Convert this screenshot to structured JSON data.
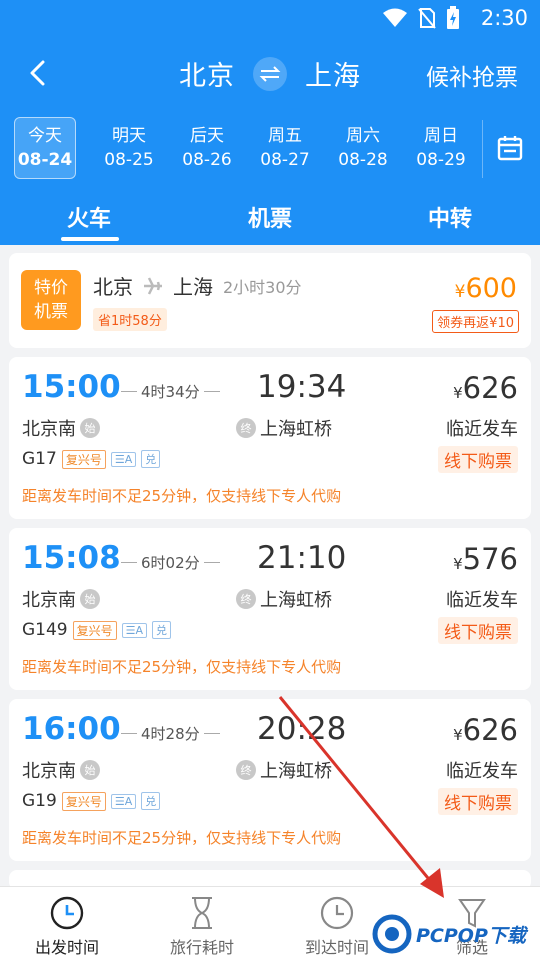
{
  "status": {
    "time": "2:30"
  },
  "header": {
    "from_city": "北京",
    "to_city": "上海",
    "right_action": "候补抢票"
  },
  "dates": [
    {
      "label": "今天",
      "date": "08-24",
      "active": true
    },
    {
      "label": "明天",
      "date": "08-25"
    },
    {
      "label": "后天",
      "date": "08-26"
    },
    {
      "label": "周五",
      "date": "08-27"
    },
    {
      "label": "周六",
      "date": "08-28"
    },
    {
      "label": "周日",
      "date": "08-29"
    }
  ],
  "tabs": [
    {
      "label": "火车",
      "active": true
    },
    {
      "label": "机票"
    },
    {
      "label": "中转"
    }
  ],
  "promo": {
    "badge": "特价机票",
    "from": "北京",
    "to": "上海",
    "duration": "2小时30分",
    "save": "省1时58分",
    "price_symbol": "¥",
    "price": "600",
    "coupon": "领券再返¥10"
  },
  "trains": [
    {
      "dep_time": "15:00",
      "duration": "4时34分",
      "arr_time": "19:34",
      "price_symbol": "¥",
      "price": "626",
      "from": "北京南",
      "from_mark": "始",
      "to": "上海虹桥",
      "to_mark": "终",
      "status": "临近发车",
      "train_no": "G17",
      "tag": "复兴号",
      "tag2": "☰A",
      "tag3": "兑",
      "buy": "线下购票",
      "note": "距离发车时间不足25分钟，仅支持线下专人代购"
    },
    {
      "dep_time": "15:08",
      "duration": "6时02分",
      "arr_time": "21:10",
      "price_symbol": "¥",
      "price": "576",
      "from": "北京南",
      "from_mark": "始",
      "to": "上海虹桥",
      "to_mark": "终",
      "status": "临近发车",
      "train_no": "G149",
      "tag": "复兴号",
      "tag2": "☰A",
      "tag3": "兑",
      "buy": "线下购票",
      "note": "距离发车时间不足25分钟，仅支持线下专人代购"
    },
    {
      "dep_time": "16:00",
      "duration": "4时28分",
      "arr_time": "20:28",
      "price_symbol": "¥",
      "price": "626",
      "from": "北京南",
      "from_mark": "始",
      "to": "上海虹桥",
      "to_mark": "终",
      "status": "临近发车",
      "train_no": "G19",
      "tag": "复兴号",
      "tag2": "☰A",
      "tag3": "兑",
      "buy": "线下购票",
      "note": "距离发车时间不足25分钟，仅支持线下专人代购"
    }
  ],
  "bottom_nav": [
    {
      "label": "出发时间",
      "icon": "clock-icon",
      "active": true
    },
    {
      "label": "旅行耗时",
      "icon": "hourglass-icon"
    },
    {
      "label": "到达时间",
      "icon": "clock-icon"
    },
    {
      "label": "筛选",
      "icon": "filter-icon"
    }
  ],
  "watermark": {
    "text": "PCPOP下载"
  },
  "colors": {
    "primary": "#1e90f6",
    "orange": "#ff8a00",
    "warning": "#f5832a"
  }
}
